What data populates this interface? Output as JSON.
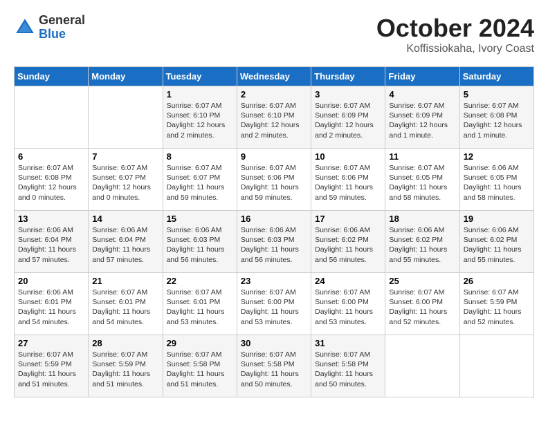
{
  "header": {
    "logo": {
      "general": "General",
      "blue": "Blue"
    },
    "title": "October 2024",
    "location": "Koffissiokaha, Ivory Coast"
  },
  "days_of_week": [
    "Sunday",
    "Monday",
    "Tuesday",
    "Wednesday",
    "Thursday",
    "Friday",
    "Saturday"
  ],
  "weeks": [
    [
      {
        "day": "",
        "info": ""
      },
      {
        "day": "",
        "info": ""
      },
      {
        "day": "1",
        "info": "Sunrise: 6:07 AM\nSunset: 6:10 PM\nDaylight: 12 hours and 2 minutes."
      },
      {
        "day": "2",
        "info": "Sunrise: 6:07 AM\nSunset: 6:10 PM\nDaylight: 12 hours and 2 minutes."
      },
      {
        "day": "3",
        "info": "Sunrise: 6:07 AM\nSunset: 6:09 PM\nDaylight: 12 hours and 2 minutes."
      },
      {
        "day": "4",
        "info": "Sunrise: 6:07 AM\nSunset: 6:09 PM\nDaylight: 12 hours and 1 minute."
      },
      {
        "day": "5",
        "info": "Sunrise: 6:07 AM\nSunset: 6:08 PM\nDaylight: 12 hours and 1 minute."
      }
    ],
    [
      {
        "day": "6",
        "info": "Sunrise: 6:07 AM\nSunset: 6:08 PM\nDaylight: 12 hours and 0 minutes."
      },
      {
        "day": "7",
        "info": "Sunrise: 6:07 AM\nSunset: 6:07 PM\nDaylight: 12 hours and 0 minutes."
      },
      {
        "day": "8",
        "info": "Sunrise: 6:07 AM\nSunset: 6:07 PM\nDaylight: 11 hours and 59 minutes."
      },
      {
        "day": "9",
        "info": "Sunrise: 6:07 AM\nSunset: 6:06 PM\nDaylight: 11 hours and 59 minutes."
      },
      {
        "day": "10",
        "info": "Sunrise: 6:07 AM\nSunset: 6:06 PM\nDaylight: 11 hours and 59 minutes."
      },
      {
        "day": "11",
        "info": "Sunrise: 6:07 AM\nSunset: 6:05 PM\nDaylight: 11 hours and 58 minutes."
      },
      {
        "day": "12",
        "info": "Sunrise: 6:06 AM\nSunset: 6:05 PM\nDaylight: 11 hours and 58 minutes."
      }
    ],
    [
      {
        "day": "13",
        "info": "Sunrise: 6:06 AM\nSunset: 6:04 PM\nDaylight: 11 hours and 57 minutes."
      },
      {
        "day": "14",
        "info": "Sunrise: 6:06 AM\nSunset: 6:04 PM\nDaylight: 11 hours and 57 minutes."
      },
      {
        "day": "15",
        "info": "Sunrise: 6:06 AM\nSunset: 6:03 PM\nDaylight: 11 hours and 56 minutes."
      },
      {
        "day": "16",
        "info": "Sunrise: 6:06 AM\nSunset: 6:03 PM\nDaylight: 11 hours and 56 minutes."
      },
      {
        "day": "17",
        "info": "Sunrise: 6:06 AM\nSunset: 6:02 PM\nDaylight: 11 hours and 56 minutes."
      },
      {
        "day": "18",
        "info": "Sunrise: 6:06 AM\nSunset: 6:02 PM\nDaylight: 11 hours and 55 minutes."
      },
      {
        "day": "19",
        "info": "Sunrise: 6:06 AM\nSunset: 6:02 PM\nDaylight: 11 hours and 55 minutes."
      }
    ],
    [
      {
        "day": "20",
        "info": "Sunrise: 6:06 AM\nSunset: 6:01 PM\nDaylight: 11 hours and 54 minutes."
      },
      {
        "day": "21",
        "info": "Sunrise: 6:07 AM\nSunset: 6:01 PM\nDaylight: 11 hours and 54 minutes."
      },
      {
        "day": "22",
        "info": "Sunrise: 6:07 AM\nSunset: 6:01 PM\nDaylight: 11 hours and 53 minutes."
      },
      {
        "day": "23",
        "info": "Sunrise: 6:07 AM\nSunset: 6:00 PM\nDaylight: 11 hours and 53 minutes."
      },
      {
        "day": "24",
        "info": "Sunrise: 6:07 AM\nSunset: 6:00 PM\nDaylight: 11 hours and 53 minutes."
      },
      {
        "day": "25",
        "info": "Sunrise: 6:07 AM\nSunset: 6:00 PM\nDaylight: 11 hours and 52 minutes."
      },
      {
        "day": "26",
        "info": "Sunrise: 6:07 AM\nSunset: 5:59 PM\nDaylight: 11 hours and 52 minutes."
      }
    ],
    [
      {
        "day": "27",
        "info": "Sunrise: 6:07 AM\nSunset: 5:59 PM\nDaylight: 11 hours and 51 minutes."
      },
      {
        "day": "28",
        "info": "Sunrise: 6:07 AM\nSunset: 5:59 PM\nDaylight: 11 hours and 51 minutes."
      },
      {
        "day": "29",
        "info": "Sunrise: 6:07 AM\nSunset: 5:58 PM\nDaylight: 11 hours and 51 minutes."
      },
      {
        "day": "30",
        "info": "Sunrise: 6:07 AM\nSunset: 5:58 PM\nDaylight: 11 hours and 50 minutes."
      },
      {
        "day": "31",
        "info": "Sunrise: 6:07 AM\nSunset: 5:58 PM\nDaylight: 11 hours and 50 minutes."
      },
      {
        "day": "",
        "info": ""
      },
      {
        "day": "",
        "info": ""
      }
    ]
  ]
}
